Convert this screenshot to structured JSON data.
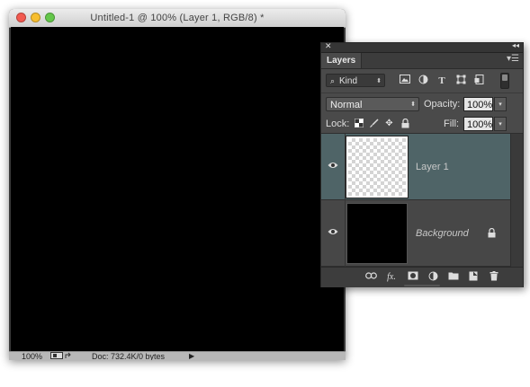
{
  "document": {
    "title": "Untitled-1 @ 100% (Layer 1, RGB/8) *",
    "status": {
      "zoom": "100%",
      "doc_info": "Doc: 732.4K/0 bytes"
    }
  },
  "layers_panel": {
    "tab_label": "Layers",
    "filter": {
      "kind_label": "Kind",
      "icons": [
        "image-filter-icon",
        "adjustment-filter-icon",
        "type-filter-icon",
        "shape-filter-icon",
        "smart-object-filter-icon"
      ]
    },
    "blend_mode": "Normal",
    "opacity_label": "Opacity:",
    "opacity_value": "100%",
    "lock_label": "Lock:",
    "fill_label": "Fill:",
    "fill_value": "100%",
    "layers": [
      {
        "name": "Layer 1",
        "selected": true,
        "visible": true,
        "thumbnail": "transparent"
      },
      {
        "name": "Background",
        "selected": false,
        "visible": true,
        "thumbnail": "black",
        "locked": true
      }
    ],
    "bottom_icons": [
      "link-layers-icon",
      "fx-icon",
      "add-mask-icon",
      "adjustment-layer-icon",
      "new-group-icon",
      "new-layer-icon",
      "trash-icon"
    ]
  },
  "colors": {
    "selected_layer": "#4f6467",
    "panel_bg": "#4a4a4a",
    "canvas": "#000000"
  }
}
